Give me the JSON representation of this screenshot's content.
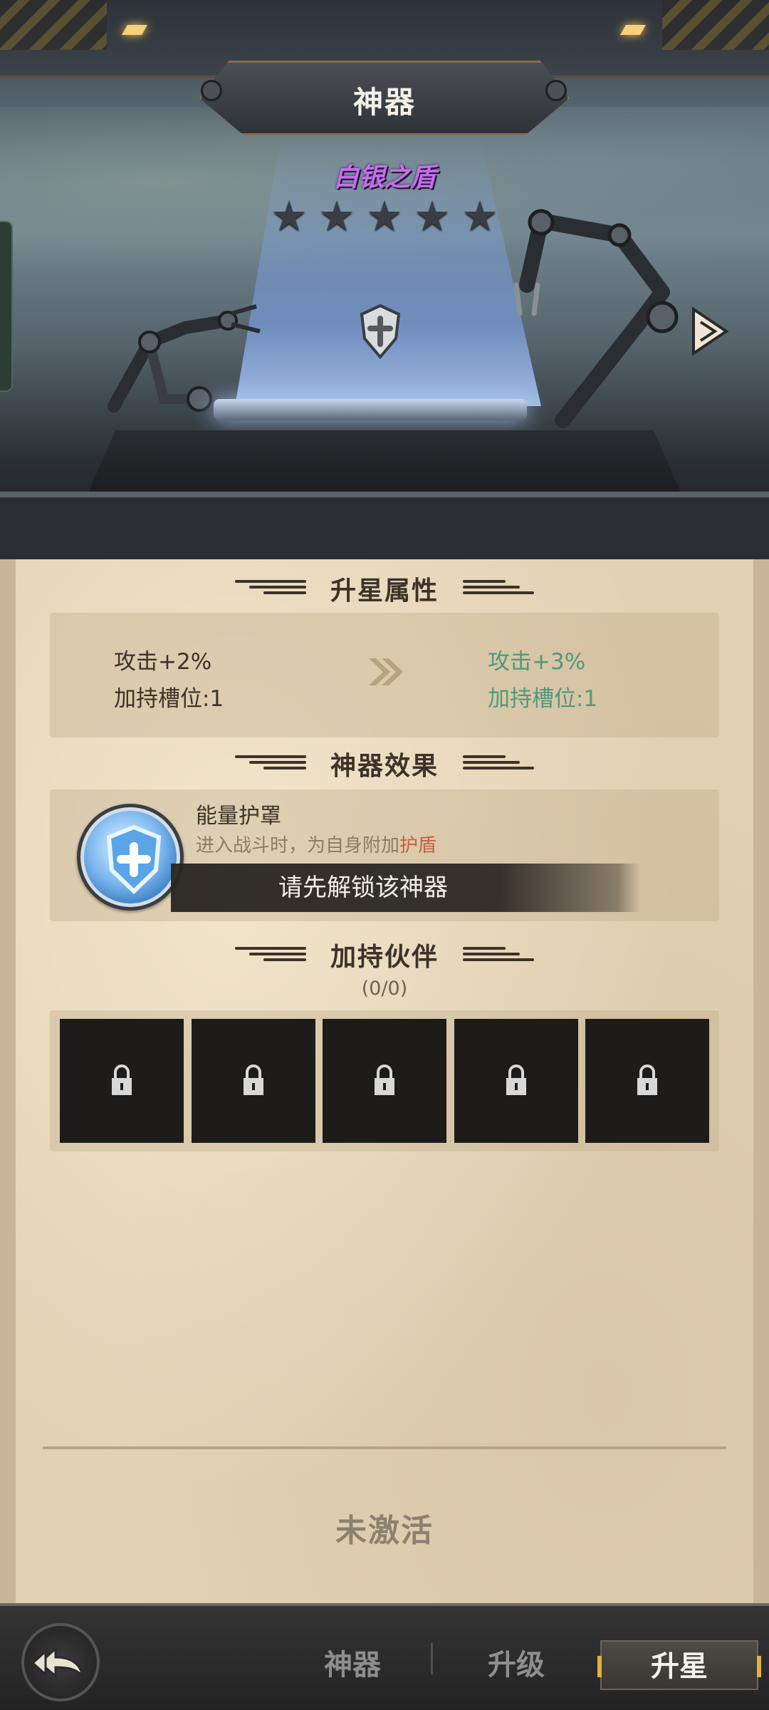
{
  "header": {
    "title": "神器"
  },
  "artifact": {
    "name": "白银之盾",
    "stars_total": 5,
    "stars_filled": 0
  },
  "upgrade_attributes": {
    "title": "升星属性",
    "current": [
      "攻击+2%",
      "加持槽位:1"
    ],
    "next": [
      "攻击+3%",
      "加持槽位:1"
    ]
  },
  "artifact_effect": {
    "title": "神器效果",
    "name": "能量护罩",
    "desc_prefix": "进入战斗时，为自身附加",
    "desc_highlight": "护盾",
    "lock_message": "请先解锁该神器"
  },
  "partners": {
    "title": "加持伙伴",
    "count": "(0/0)",
    "slots": [
      "locked",
      "locked",
      "locked",
      "locked",
      "locked"
    ]
  },
  "status": {
    "label": "未激活"
  },
  "bottom_nav": {
    "tabs": [
      "神器",
      "升级",
      "升星"
    ],
    "active": "升星"
  },
  "colors": {
    "name": "#c86df0",
    "next_stat": "#4f9a78",
    "highlight": "#c5603c"
  }
}
